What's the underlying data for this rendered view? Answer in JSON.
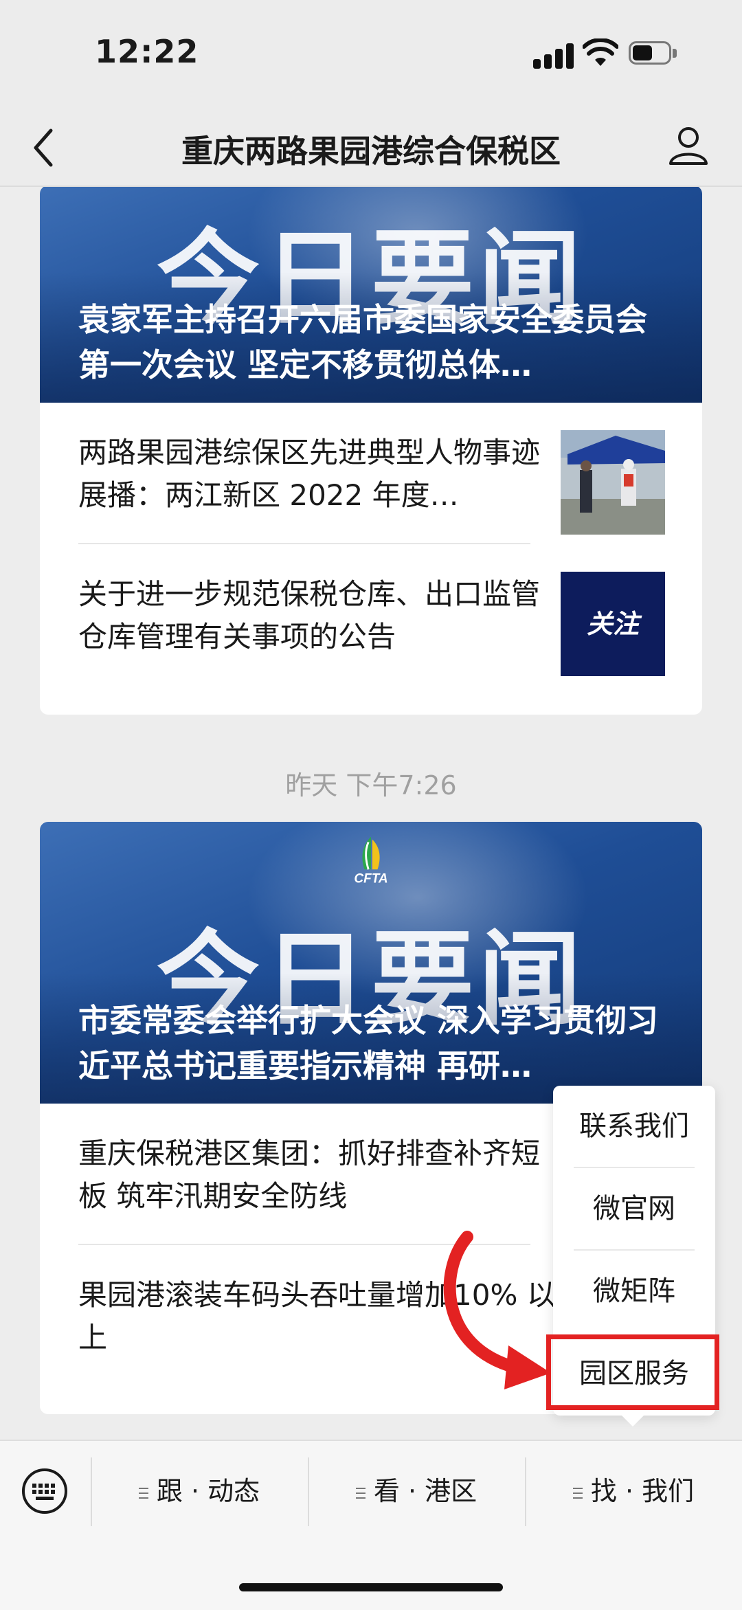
{
  "status_bar": {
    "time": "12:22"
  },
  "nav": {
    "title": "重庆两路果园港综合保税区"
  },
  "feed": {
    "group1": {
      "hero_big_title": "今日要闻",
      "hero_caption": "袁家军主持召开六届市委国家安全委员会第一次会议 坚定不移贯彻总体…",
      "articles": [
        {
          "title": "两路果园港综保区先进典型人物事迹展播：两江新区 2022 年度…"
        },
        {
          "title": "关于进一步规范保税仓库、出口监管仓库管理有关事项的公告",
          "thumb_text": "关注"
        }
      ]
    },
    "timestamp": "昨天 下午7:26",
    "group2": {
      "hero_logo_text": "CFTA",
      "hero_big_title": "今日要闻",
      "hero_caption": "市委常委会举行扩大会议 深入学习贯彻习近平总书记重要指示精神 再研…",
      "articles": [
        {
          "title": "重庆保税港区集团：抓好排查补齐短板 筑牢汛期安全防线"
        },
        {
          "title": "果园港滚装车码头吞吐量增加10% 以上"
        }
      ]
    }
  },
  "popup_menu": {
    "items": [
      {
        "label": "联系我们"
      },
      {
        "label": "微官网"
      },
      {
        "label": "微矩阵"
      },
      {
        "label": "园区服务"
      }
    ],
    "highlighted_item": "园区服务",
    "highlight_color": "#e32222"
  },
  "bottom_menu": {
    "items": [
      {
        "label": "跟 · 动态"
      },
      {
        "label": "看 · 港区"
      },
      {
        "label": "找 · 我们"
      }
    ]
  },
  "colors": {
    "hero_blue": "#1f4e96",
    "thumb_navy": "#0d1c5c",
    "annotation_red": "#e32222"
  }
}
